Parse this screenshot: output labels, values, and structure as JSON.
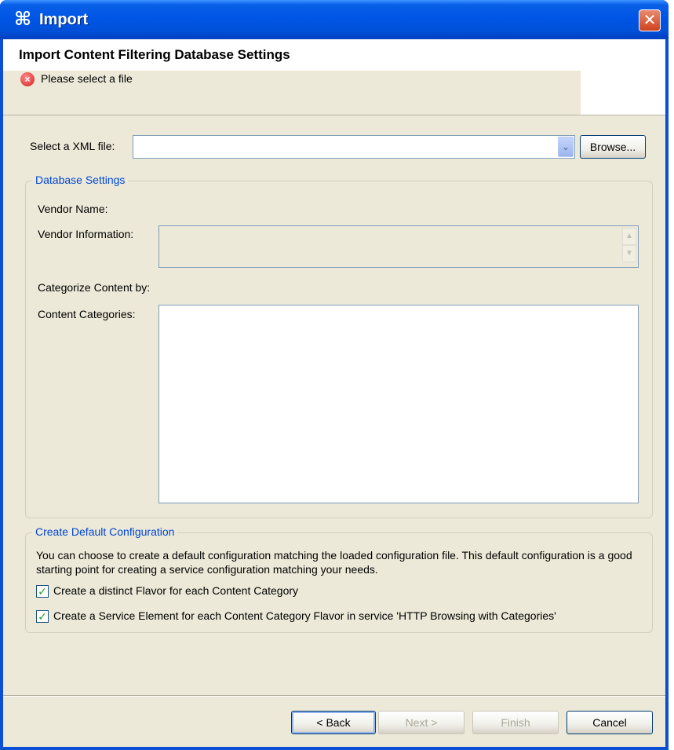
{
  "window": {
    "title": "Import",
    "title_icon": "⌘",
    "close_glyph": "✕"
  },
  "header": {
    "title": "Import Content Filtering Database Settings",
    "error_message": "Please select a file",
    "error_icon": "×"
  },
  "file_select": {
    "label": "Select a XML file:",
    "value": "",
    "dropdown_glyph": "⌄",
    "browse_label": "Browse..."
  },
  "database_settings": {
    "title": "Database Settings",
    "vendor_name_label": "Vendor Name:",
    "vendor_name_value": "",
    "vendor_info_label": "Vendor Information:",
    "vendor_info_value": "",
    "categorize_label": "Categorize Content by:",
    "categorize_value": "",
    "content_categories_label": "Content Categories:",
    "scroll_up_glyph": "▲",
    "scroll_down_glyph": "▼"
  },
  "default_config": {
    "title": "Create Default Configuration",
    "description": "You can choose to create a default configuration matching the loaded configuration file.  This default configuration is a good starting point for creating a service configuration matching your needs.",
    "checkbox1_label": "Create a distinct Flavor for each Content Category",
    "checkbox1_checked": true,
    "checkbox2_label": "Create a Service Element for each Content Category Flavor in service 'HTTP Browsing with Categories'",
    "checkbox2_checked": true,
    "check_glyph": "✓"
  },
  "footer": {
    "back_label": "< Back",
    "next_label": "Next >",
    "finish_label": "Finish",
    "cancel_label": "Cancel"
  }
}
